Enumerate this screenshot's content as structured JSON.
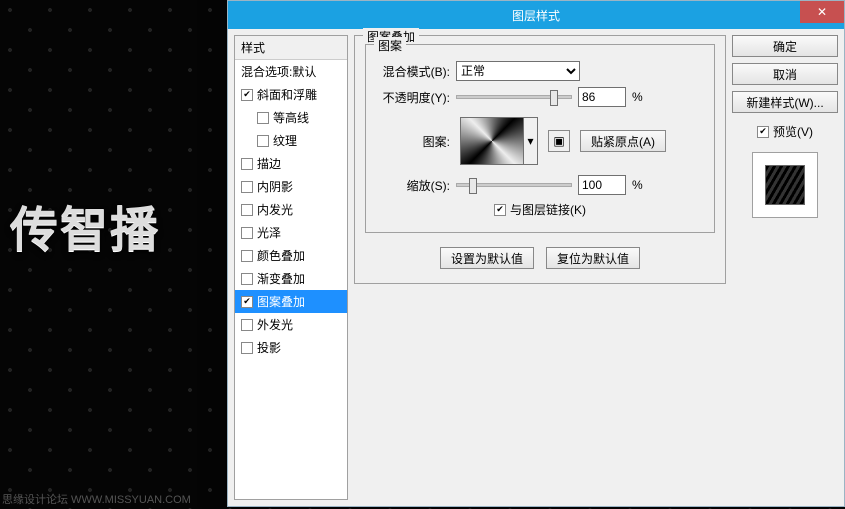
{
  "background": {
    "artwork_text": "传智播",
    "watermark": "思缘设计论坛  WWW.MISSYUAN.COM"
  },
  "dialog": {
    "title": "图层样式",
    "close": "✕",
    "styles_header": "样式",
    "styles": [
      {
        "label": "混合选项:默认",
        "checked": null
      },
      {
        "label": "斜面和浮雕",
        "checked": true
      },
      {
        "label": "等高线",
        "checked": false,
        "indent": true
      },
      {
        "label": "纹理",
        "checked": false,
        "indent": true
      },
      {
        "label": "描边",
        "checked": false
      },
      {
        "label": "内阴影",
        "checked": false
      },
      {
        "label": "内发光",
        "checked": false
      },
      {
        "label": "光泽",
        "checked": false
      },
      {
        "label": "颜色叠加",
        "checked": false
      },
      {
        "label": "渐变叠加",
        "checked": false
      },
      {
        "label": "图案叠加",
        "checked": true,
        "selected": true
      },
      {
        "label": "外发光",
        "checked": false
      },
      {
        "label": "投影",
        "checked": false
      }
    ],
    "panel": {
      "group_title": "图案叠加",
      "inner_title": "图案",
      "blend_label": "混合模式(B):",
      "blend_value": "正常",
      "opacity_label": "不透明度(Y):",
      "opacity_value": "86",
      "opacity_pct": 86,
      "percent": "%",
      "pattern_label": "图案:",
      "snap_origin": "贴紧原点(A)",
      "scale_label": "缩放(S):",
      "scale_value": "100",
      "scale_pct": 100,
      "link_label": "与图层链接(K)",
      "link_checked": true,
      "set_default": "设置为默认值",
      "reset_default": "复位为默认值"
    },
    "buttons": {
      "ok": "确定",
      "cancel": "取消",
      "new_style": "新建样式(W)...",
      "preview": "预览(V)",
      "preview_checked": true
    }
  }
}
